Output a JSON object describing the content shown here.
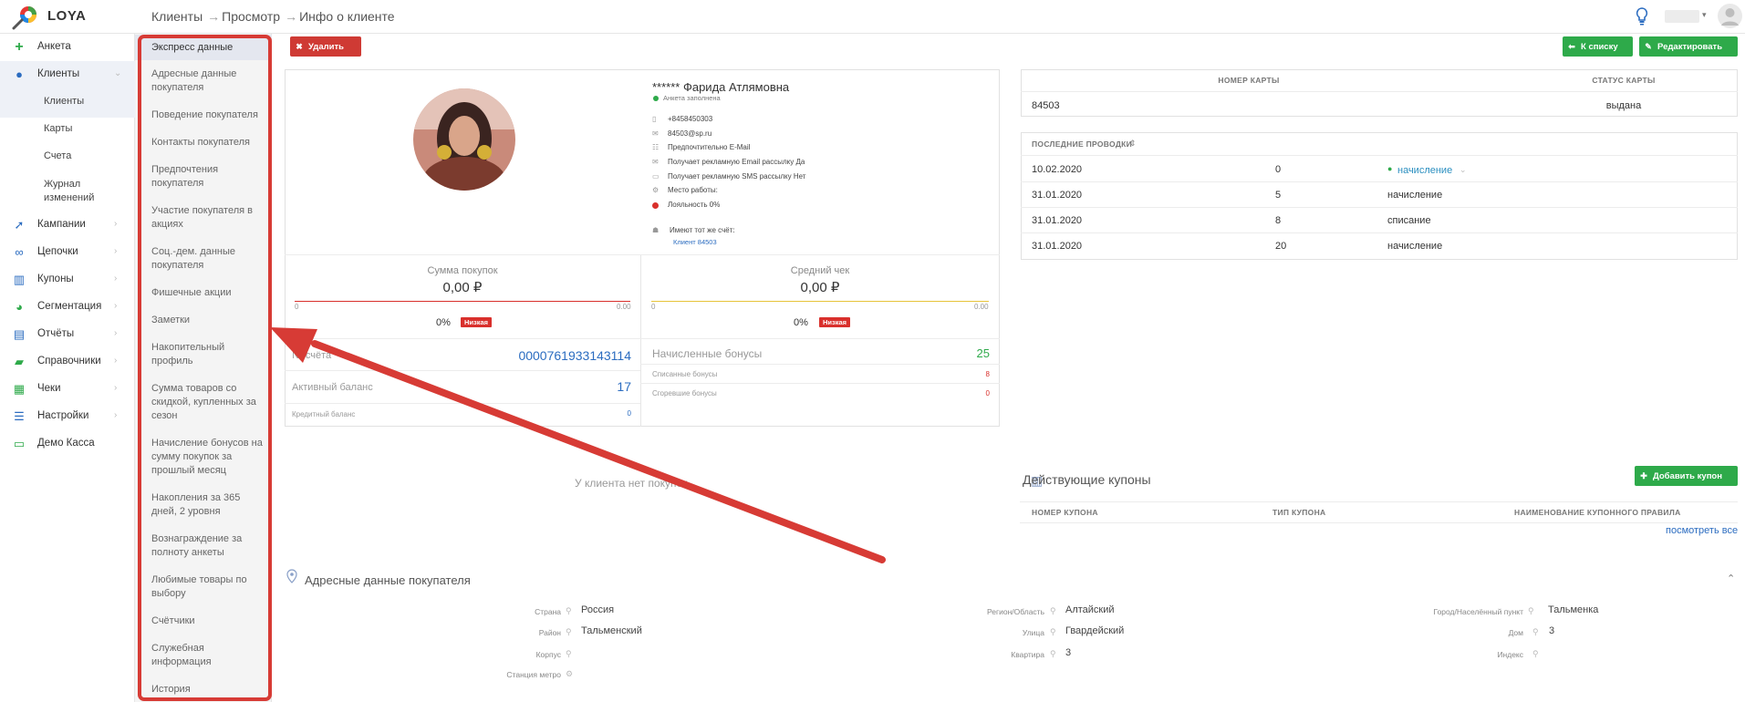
{
  "app": {
    "logo_text": "LOYA"
  },
  "breadcrumb": [
    "Клиенты",
    "Просмотр",
    "Инфо о клиенте"
  ],
  "sidebar": {
    "items": [
      {
        "label": "Анкета",
        "icon": "plus-icon"
      },
      {
        "label": "Клиенты",
        "icon": "user-icon"
      },
      {
        "label": "Кампании",
        "icon": "rocket-icon"
      },
      {
        "label": "Цепочки",
        "icon": "chain-icon"
      },
      {
        "label": "Купоны",
        "icon": "barcode-icon"
      },
      {
        "label": "Сегментация",
        "icon": "pie-icon"
      },
      {
        "label": "Отчёты",
        "icon": "bar-chart-icon"
      },
      {
        "label": "Справочники",
        "icon": "book-icon"
      },
      {
        "label": "Чеки",
        "icon": "receipt-icon"
      },
      {
        "label": "Настройки",
        "icon": "sliders-icon"
      },
      {
        "label": "Демо Касса",
        "icon": "laptop-icon"
      }
    ],
    "sub_items": [
      "Клиенты",
      "Карты",
      "Счета",
      "Журнал изменений"
    ]
  },
  "submenu": [
    "Экспресс данные",
    "Адресные данные покупателя",
    "Поведение покупателя",
    "Контакты покупателя",
    "Предпочтения покупателя",
    "Участие покупателя в акциях",
    "Соц.-дем. данные покупателя",
    "Фишечные акции",
    "Заметки",
    "Накопительный профиль",
    "Сумма товаров со скидкой, купленных за сезон",
    "Начисление бонусов на сумму покупок за прошлый месяц",
    "Накопления за 365 дней, 2 уровня",
    "Вознаграждение за полноту анкеты",
    "Любимые товары по выбору",
    "Счётчики",
    "Служебная информация",
    "История"
  ],
  "buttons": {
    "delete": "Удалить",
    "to_list": "К списку",
    "edit": "Редактировать",
    "add_coupon": "Добавить купон"
  },
  "profile": {
    "name": "****** Фарида Атлямовна",
    "status": "Анкета заполнена",
    "phone": "+8458450303",
    "email": "84503@sp.ru",
    "pref": "Предпочтительно E-Mail",
    "email_ads": "Получает рекламную Email рассылку Да",
    "sms_ads": "Получает рекламную SMS рассылку Нет",
    "work": "Место работы:",
    "loyalty": "Лояльность 0%",
    "shared": "Имеют тот же счёт:",
    "shared_client": "Клиент 84503"
  },
  "stats": {
    "sum_label": "Сумма покупок",
    "sum_value": "0,00 ₽",
    "sum_min": "0",
    "sum_max": "0.00",
    "sum_pct": "0%",
    "sum_level": "Низкая",
    "avg_label": "Средний чек",
    "avg_value": "0,00 ₽",
    "avg_min": "0",
    "avg_max": "0.00",
    "avg_pct": "0%",
    "avg_level": "Низкая",
    "sum_fill": 0,
    "avg_fill": 0
  },
  "account": {
    "number_label": "№ счёта",
    "number": "0000761933143114",
    "active_label": "Активный баланс",
    "active": "17",
    "credit_label": "Кредитный баланс",
    "credit": "0",
    "bonus_label": "Начисленные бонусы",
    "bonus": "25",
    "spent_label": "Списанные бонусы",
    "spent": "8",
    "burned_label": "Сгоревшие бонусы",
    "burned": "0"
  },
  "card": {
    "col_number": "НОМЕР КАРТЫ",
    "col_status": "СТАТУС КАРТЫ",
    "number": "84503",
    "status": "выдана"
  },
  "transactions": {
    "header": "ПОСЛЕДНИЕ ПРОВОДКИ",
    "rows": [
      {
        "date": "10.02.2020",
        "amount": "0",
        "type": "начисление"
      },
      {
        "date": "31.01.2020",
        "amount": "5",
        "type": "начисление"
      },
      {
        "date": "31.01.2020",
        "amount": "8",
        "type": "списание"
      },
      {
        "date": "31.01.2020",
        "amount": "20",
        "type": "начисление"
      }
    ]
  },
  "purchases": {
    "empty": "У клиента нет покупок"
  },
  "coupons": {
    "title": "Действующие купоны",
    "col_number": "НОМЕР КУПОНА",
    "col_type": "ТИП КУПОНА",
    "col_rule": "НАИМЕНОВАНИЕ КУПОННОГО ПРАВИЛА",
    "see_all": "посмотреть все"
  },
  "address": {
    "title": "Адресные данные покупателя",
    "fields": [
      {
        "label": "Страна",
        "value": "Россия"
      },
      {
        "label": "Район",
        "value": "Тальменский"
      },
      {
        "label": "Корпус",
        "value": ""
      },
      {
        "label": "Станция метро",
        "value": ""
      },
      {
        "label": "Регион/Область",
        "value": "Алтайский"
      },
      {
        "label": "Улица",
        "value": "Гвардейский"
      },
      {
        "label": "Квартира",
        "value": "3"
      },
      {
        "label": "Город/Населённый пункт",
        "value": "Тальменка"
      },
      {
        "label": "Дом",
        "value": "3"
      },
      {
        "label": "Индекс",
        "value": ""
      }
    ]
  },
  "colors": {
    "accent_green": "#2eaa4a",
    "danger_red": "#d9302c",
    "link_blue": "#2b6cc0"
  }
}
